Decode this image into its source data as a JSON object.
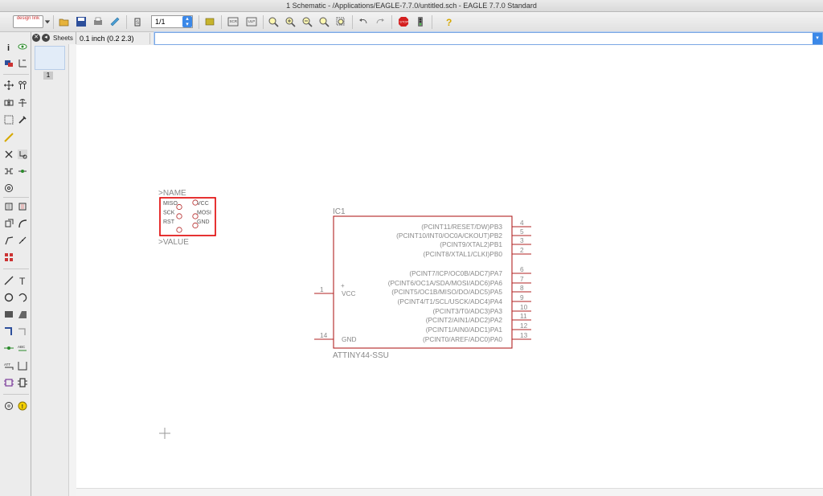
{
  "window": {
    "title": "1 Schematic - /Applications/EAGLE-7.7.0/untitled.sch - EAGLE 7.7.0 Standard"
  },
  "toolbar": {
    "logo_text": "design link",
    "sheet_value": "1/1"
  },
  "sheets_panel": {
    "label": "Sheets",
    "thumbnail_number": "1"
  },
  "coords": {
    "grid_readout": "0.1 inch (0.2 2.3)"
  },
  "command_line": {
    "value": ""
  },
  "schematic": {
    "left_part": {
      "name_label": ">NAME",
      "value_label": ">VALUE",
      "pins_left": [
        "MISO",
        "SCK",
        "RST"
      ],
      "pins_right": [
        "VCC",
        "MOSI",
        "GND"
      ]
    },
    "ic": {
      "name": "IC1",
      "device": "ATTINY44-SSU",
      "left_pins": [
        {
          "label": "VCC",
          "number": "1",
          "marker": "+"
        },
        {
          "label": "GND",
          "number": "14"
        }
      ],
      "right_pins": [
        {
          "label": "(PCINT11/RESET/DW)PB3",
          "number": "4"
        },
        {
          "label": "(PCINT10/INT0/OC0A/CKOUT)PB2",
          "number": "5"
        },
        {
          "label": "(PCINT9/XTAL2)PB1",
          "number": "3"
        },
        {
          "label": "(PCINT8/XTAL1/CLKI)PB0",
          "number": "2"
        },
        {
          "label": "(PCINT7/ICP/OC0B/ADC7)PA7",
          "number": "6"
        },
        {
          "label": "(PCINT6/OC1A/SDA/MOSI/ADC6)PA6",
          "number": "7"
        },
        {
          "label": "(PCINT5/OC1B/MISO/DO/ADC5)PA5",
          "number": "8"
        },
        {
          "label": "(PCINT4/T1/SCL/USCK/ADC4)PA4",
          "number": "9"
        },
        {
          "label": "(PCINT3/T0/ADC3)PA3",
          "number": "10"
        },
        {
          "label": "(PCINT2/AIN1/ADC2)PA2",
          "number": "11"
        },
        {
          "label": "(PCINT1/AIN0/ADC1)PA1",
          "number": "12"
        },
        {
          "label": "(PCINT0/AREF/ADC0)PA0",
          "number": "13"
        }
      ]
    }
  },
  "colors": {
    "symbol": "#b22222",
    "text": "#888888",
    "selection": "#e00000",
    "canvas": "#ffffff"
  }
}
